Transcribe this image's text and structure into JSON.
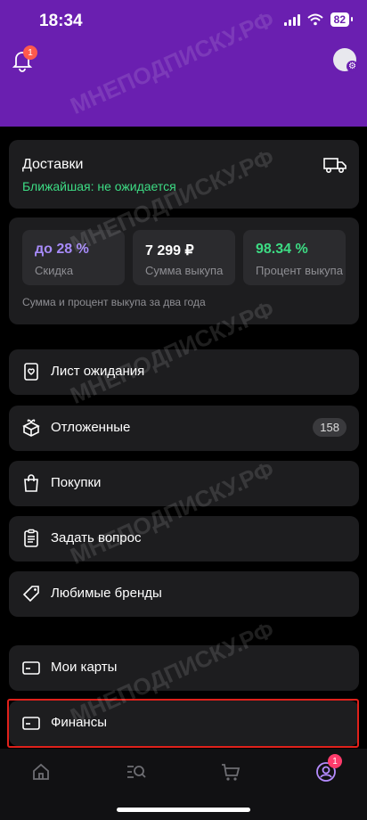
{
  "status": {
    "time": "18:34",
    "battery": "82"
  },
  "header": {
    "bell_badge": "1"
  },
  "delivery": {
    "title": "Доставки",
    "subtitle": "Ближайшая: не ожидается"
  },
  "stats": {
    "items": [
      {
        "value": "до 28 %",
        "label": "Скидка",
        "color": "#a78bfa"
      },
      {
        "value": "7 299 ₽",
        "label": "Сумма выкупа",
        "color": "#ffffff"
      },
      {
        "value": "98.34 %",
        "label": "Процент выкупа",
        "color": "#3ddc84"
      }
    ],
    "note": "Сумма и процент выкупа за два года"
  },
  "menu": [
    {
      "label": "Лист ожидания",
      "icon": "waitlist-icon"
    },
    {
      "label": "Отложенные",
      "icon": "gift-box-icon",
      "count": "158"
    },
    {
      "label": "Покупки",
      "icon": "shopping-bag-icon"
    },
    {
      "label": "Задать вопрос",
      "icon": "clipboard-icon"
    },
    {
      "label": "Любимые бренды",
      "icon": "tag-icon"
    },
    {
      "label": "Мои карты",
      "icon": "card-icon"
    },
    {
      "label": "Финансы",
      "icon": "card-icon"
    }
  ],
  "tabbar": {
    "profile_badge": "1"
  },
  "watermark": "МНЕПОДПИСКУ.РФ"
}
